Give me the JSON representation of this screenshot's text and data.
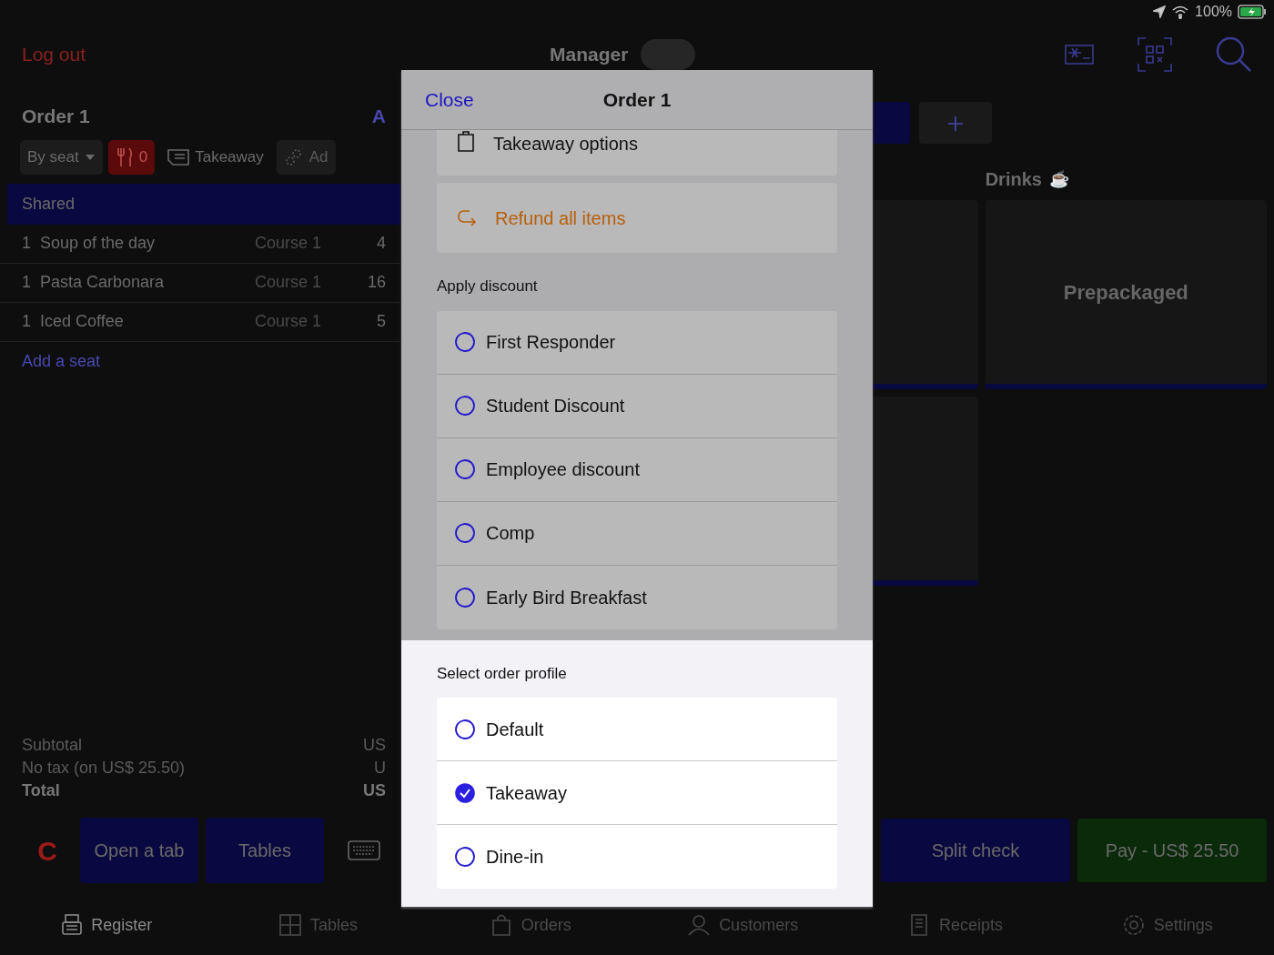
{
  "status_bar": {
    "battery": "100%"
  },
  "top_bar": {
    "logout": "Log out",
    "user": "Manager"
  },
  "order": {
    "title": "Order 1",
    "action": "A",
    "mode": "By seat",
    "guests": "0",
    "profile": "Takeaway",
    "more": "Ad",
    "section": "Shared",
    "items": [
      {
        "qty": "1",
        "name": "Soup of the day",
        "course": "Course 1",
        "price": "4"
      },
      {
        "qty": "1",
        "name": "Pasta Carbonara",
        "course": "Course 1",
        "price": "16"
      },
      {
        "qty": "1",
        "name": "Iced Coffee",
        "course": "Course 1",
        "price": "5"
      }
    ],
    "add_seat": "Add a seat",
    "totals": [
      {
        "label": "Subtotal",
        "value": "US",
        "kind": "normal"
      },
      {
        "label": "No tax (on US$ 25.50)",
        "value": "U",
        "kind": "muted"
      },
      {
        "label": "Total",
        "value": "US",
        "kind": "bold"
      }
    ],
    "clear": "C",
    "open_tab": "Open a tab",
    "tables": "Tables"
  },
  "catalog": {
    "category": "Drinks",
    "category_emoji": "☕",
    "tile": "Prepackaged"
  },
  "checkout": {
    "split": "Split check",
    "pay": "Pay - US$ 25.50"
  },
  "tab_bar": [
    {
      "label": "Register",
      "kind": "register",
      "selected": true
    },
    {
      "label": "Tables",
      "kind": "tables",
      "selected": false
    },
    {
      "label": "Orders",
      "kind": "orders",
      "selected": false
    },
    {
      "label": "Customers",
      "kind": "customers",
      "selected": false
    },
    {
      "label": "Receipts",
      "kind": "receipts",
      "selected": false
    },
    {
      "label": "Settings",
      "kind": "settings",
      "selected": false
    }
  ],
  "dialog": {
    "close": "Close",
    "title": "Order 1",
    "actions": [
      {
        "label": "Takeaway options",
        "kind": "takeaway"
      },
      {
        "label": "Refund all items",
        "kind": "refund"
      }
    ],
    "discount_heading": "Apply discount",
    "discounts": [
      {
        "label": "First Responder",
        "selected": false
      },
      {
        "label": "Student Discount",
        "selected": false
      },
      {
        "label": "Employee discount",
        "selected": false
      },
      {
        "label": "Comp",
        "selected": false
      },
      {
        "label": "Early Bird Breakfast",
        "selected": false
      }
    ],
    "profile_heading": "Select order profile",
    "profiles": [
      {
        "label": "Default",
        "selected": false
      },
      {
        "label": "Takeaway",
        "selected": true
      },
      {
        "label": "Dine-in",
        "selected": false
      }
    ]
  }
}
